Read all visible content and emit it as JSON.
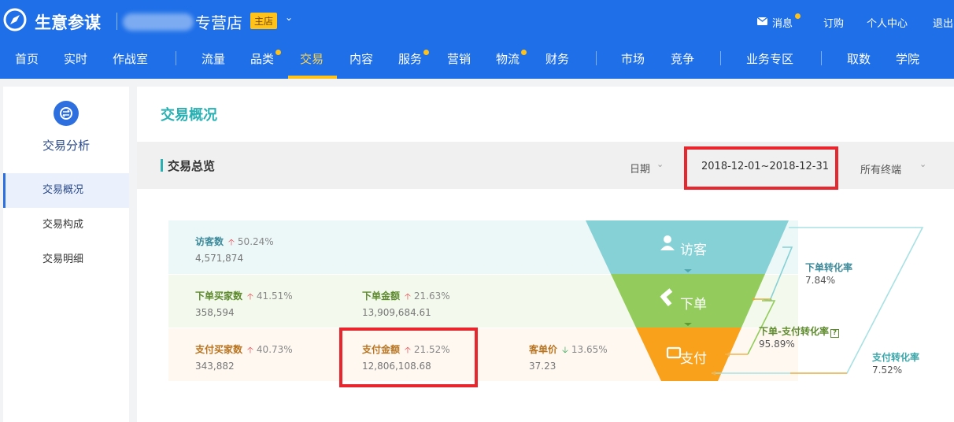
{
  "header": {
    "brand": "生意参谋",
    "store_suffix": "专营店",
    "store_badge": "主店",
    "top_links": {
      "messages": "消息",
      "subscribe": "订购",
      "personal": "个人中心",
      "logout": "退出"
    }
  },
  "nav": {
    "items": [
      {
        "label": "首页"
      },
      {
        "label": "实时"
      },
      {
        "label": "作战室"
      },
      {
        "label": "流量"
      },
      {
        "label": "品类"
      },
      {
        "label": "交易"
      },
      {
        "label": "内容"
      },
      {
        "label": "服务"
      },
      {
        "label": "营销"
      },
      {
        "label": "物流"
      },
      {
        "label": "财务"
      },
      {
        "label": "市场"
      },
      {
        "label": "竞争"
      },
      {
        "label": "业务专区"
      },
      {
        "label": "取数"
      },
      {
        "label": "学院"
      }
    ],
    "active": "交易"
  },
  "sidebar": {
    "title": "交易分析",
    "items": [
      {
        "label": "交易概况"
      },
      {
        "label": "交易构成"
      },
      {
        "label": "交易明细"
      }
    ]
  },
  "main": {
    "page_title": "交易概况",
    "section_title": "交易总览",
    "date_label": "日期",
    "date_range": "2018-12-01~2018-12-31",
    "terminal_label": "所有终端"
  },
  "metrics": {
    "visitors": {
      "label": "访客数",
      "pct": "50.24%",
      "value": "4,571,874"
    },
    "order_buyers": {
      "label": "下单买家数",
      "pct": "41.51%",
      "value": "358,594"
    },
    "order_amount": {
      "label": "下单金额",
      "pct": "21.63%",
      "value": "13,909,684.61"
    },
    "pay_buyers": {
      "label": "支付买家数",
      "pct": "40.73%",
      "value": "343,882"
    },
    "pay_amount": {
      "label": "支付金额",
      "pct": "21.52%",
      "value": "12,806,108.68"
    },
    "unit_price": {
      "label": "客单价",
      "pct": "13.65%",
      "value": "37.23"
    }
  },
  "funnel": {
    "stages": [
      {
        "label": "访客"
      },
      {
        "label": "下单"
      },
      {
        "label": "支付"
      }
    ],
    "rates": {
      "order_conv": {
        "label": "下单转化率",
        "value": "7.84%"
      },
      "order_pay_conv": {
        "label": "下单-支付转化率",
        "value": "95.89%"
      },
      "pay_conv": {
        "label": "支付转化率",
        "value": "7.52%"
      }
    }
  },
  "colors": {
    "header_blue": "#1e6fe8",
    "accent_yellow": "#ffc21a",
    "visit_teal": "#86d1d5",
    "order_green": "#93cc5c",
    "pay_orange": "#f9a11b",
    "highlight_red": "#e8262d"
  }
}
